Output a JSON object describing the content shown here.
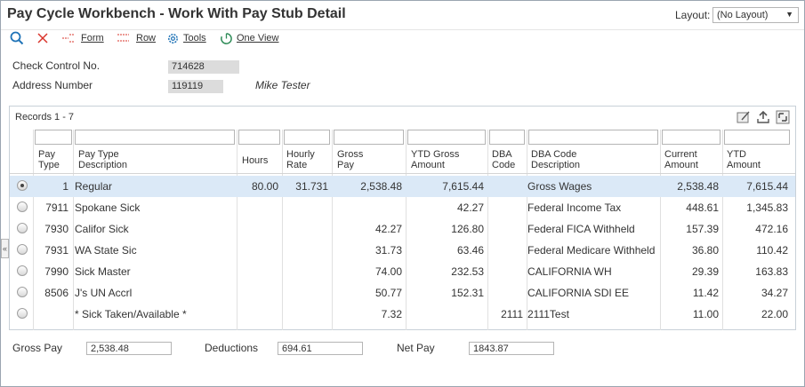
{
  "window": {
    "title": "Pay Cycle Workbench - Work With Pay Stub Detail",
    "layout_label": "Layout:",
    "layout_value": "(No Layout)"
  },
  "toolbar": {
    "form_label": "Form",
    "row_label": "Row",
    "tools_label": "Tools",
    "oneview_label": "One View"
  },
  "header": {
    "check_control_label": "Check Control No.",
    "check_control_value": "714628",
    "address_number_label": "Address Number",
    "address_number_value": "119119",
    "employee_name": "Mike Tester"
  },
  "grid": {
    "records_label": "Records 1 - 7",
    "columns": [
      {
        "line1": "Pay",
        "line2": "Type"
      },
      {
        "line1": "Pay Type",
        "line2": "Description"
      },
      {
        "line1": "Hours",
        "line2": ""
      },
      {
        "line1": "Hourly",
        "line2": "Rate"
      },
      {
        "line1": "Gross",
        "line2": "Pay"
      },
      {
        "line1": "YTD Gross",
        "line2": "Amount"
      },
      {
        "line1": "DBA",
        "line2": "Code"
      },
      {
        "line1": "DBA Code",
        "line2": "Description"
      },
      {
        "line1": "Current",
        "line2": "Amount"
      },
      {
        "line1": "YTD",
        "line2": "Amount"
      }
    ],
    "rows": [
      {
        "selected": true,
        "pay_type": "1",
        "desc": "Regular",
        "hours": "80.00",
        "rate": "31.731",
        "gross": "2,538.48",
        "ytd_gross": "7,615.44",
        "dba": "",
        "dba_desc": "Gross Wages",
        "current": "2,538.48",
        "ytd": "7,615.44"
      },
      {
        "selected": false,
        "pay_type": "7911",
        "desc": "Spokane Sick",
        "hours": "",
        "rate": "",
        "gross": "",
        "ytd_gross": "42.27",
        "dba": "",
        "dba_desc": "Federal Income Tax",
        "current": "448.61",
        "ytd": "1,345.83"
      },
      {
        "selected": false,
        "pay_type": "7930",
        "desc": "Califor Sick",
        "hours": "",
        "rate": "",
        "gross": "42.27",
        "ytd_gross": "126.80",
        "dba": "",
        "dba_desc": "Federal FICA Withheld",
        "current": "157.39",
        "ytd": "472.16"
      },
      {
        "selected": false,
        "pay_type": "7931",
        "desc": "WA State Sic",
        "hours": "",
        "rate": "",
        "gross": "31.73",
        "ytd_gross": "63.46",
        "dba": "",
        "dba_desc": "Federal Medicare Withheld",
        "current": "36.80",
        "ytd": "110.42"
      },
      {
        "selected": false,
        "pay_type": "7990",
        "desc": "Sick Master",
        "hours": "",
        "rate": "",
        "gross": "74.00",
        "ytd_gross": "232.53",
        "dba": "",
        "dba_desc": "CALIFORNIA WH",
        "current": "29.39",
        "ytd": "163.83"
      },
      {
        "selected": false,
        "pay_type": "8506",
        "desc": "J's UN Accrl",
        "hours": "",
        "rate": "",
        "gross": "50.77",
        "ytd_gross": "152.31",
        "dba": "",
        "dba_desc": "CALIFORNIA SDI EE",
        "current": "11.42",
        "ytd": "34.27"
      },
      {
        "selected": false,
        "pay_type": "",
        "desc": "* Sick Taken/Available *",
        "hours": "",
        "rate": "",
        "gross": "7.32",
        "ytd_gross": "",
        "dba": "2111",
        "dba_desc": "2111Test",
        "current": "11.00",
        "ytd": "22.00"
      }
    ]
  },
  "totals": {
    "gross_pay_label": "Gross Pay",
    "gross_pay_value": "2,538.48",
    "deductions_label": "Deductions",
    "deductions_value": "694.61",
    "net_pay_label": "Net Pay",
    "net_pay_value": "1843.87"
  },
  "colors": {
    "selected_row": "#dbe9f7",
    "icon_blue": "#1f73b7",
    "icon_red": "#d9342b"
  }
}
